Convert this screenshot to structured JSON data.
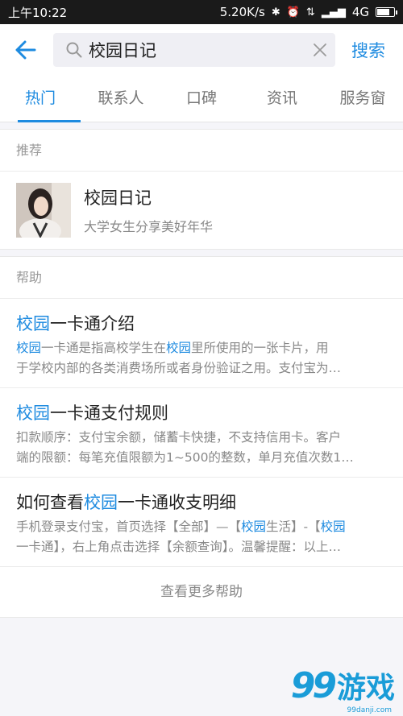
{
  "status": {
    "time": "上午10:22",
    "speed": "5.20K/s",
    "network": "4G"
  },
  "search": {
    "query": "校园日记",
    "button": "搜索"
  },
  "tabs": [
    "热门",
    "联系人",
    "口碑",
    "资讯",
    "服务窗"
  ],
  "recommend": {
    "section_title": "推荐",
    "item": {
      "name": "校园日记",
      "desc": "大学女生分享美好年华"
    }
  },
  "help": {
    "section_title": "帮助",
    "items": [
      {
        "title_hl": "校园",
        "title_rest": "一卡通介绍",
        "desc1_hl": "校园",
        "desc1_a": "一卡通是指高校学生在",
        "desc1_hl2": "校园",
        "desc1_b": "里所使用的一张卡片，用",
        "desc2": "于学校内部的各类消费场所或者身份验证之用。支付宝为…"
      },
      {
        "title_hl": "校园",
        "title_rest": "一卡通支付规则",
        "desc1": "扣款顺序：支付宝余额，储蓄卡快捷，不支持信用卡。客户",
        "desc2": "端的限额：每笔充值限额为1~500的整数，单月充值次数1…"
      },
      {
        "title_pre": "如何查看",
        "title_hl": "校园",
        "title_rest": "一卡通收支明细",
        "desc1_a": "手机登录支付宝，首页选择【全部】—【",
        "desc1_hl": "校园",
        "desc1_b": "生活】-【",
        "desc1_hl2": "校园",
        "desc2": "一卡通】，右上角点击选择【余额查询】。温馨提醒：以上…"
      }
    ],
    "more": "查看更多帮助"
  },
  "watermark": {
    "num": "99",
    "text": "游戏",
    "url": "99danji.com"
  },
  "colors": {
    "accent": "#1e8be0",
    "statusbar": "#1a1a1a",
    "background": "#f5f5f9"
  }
}
